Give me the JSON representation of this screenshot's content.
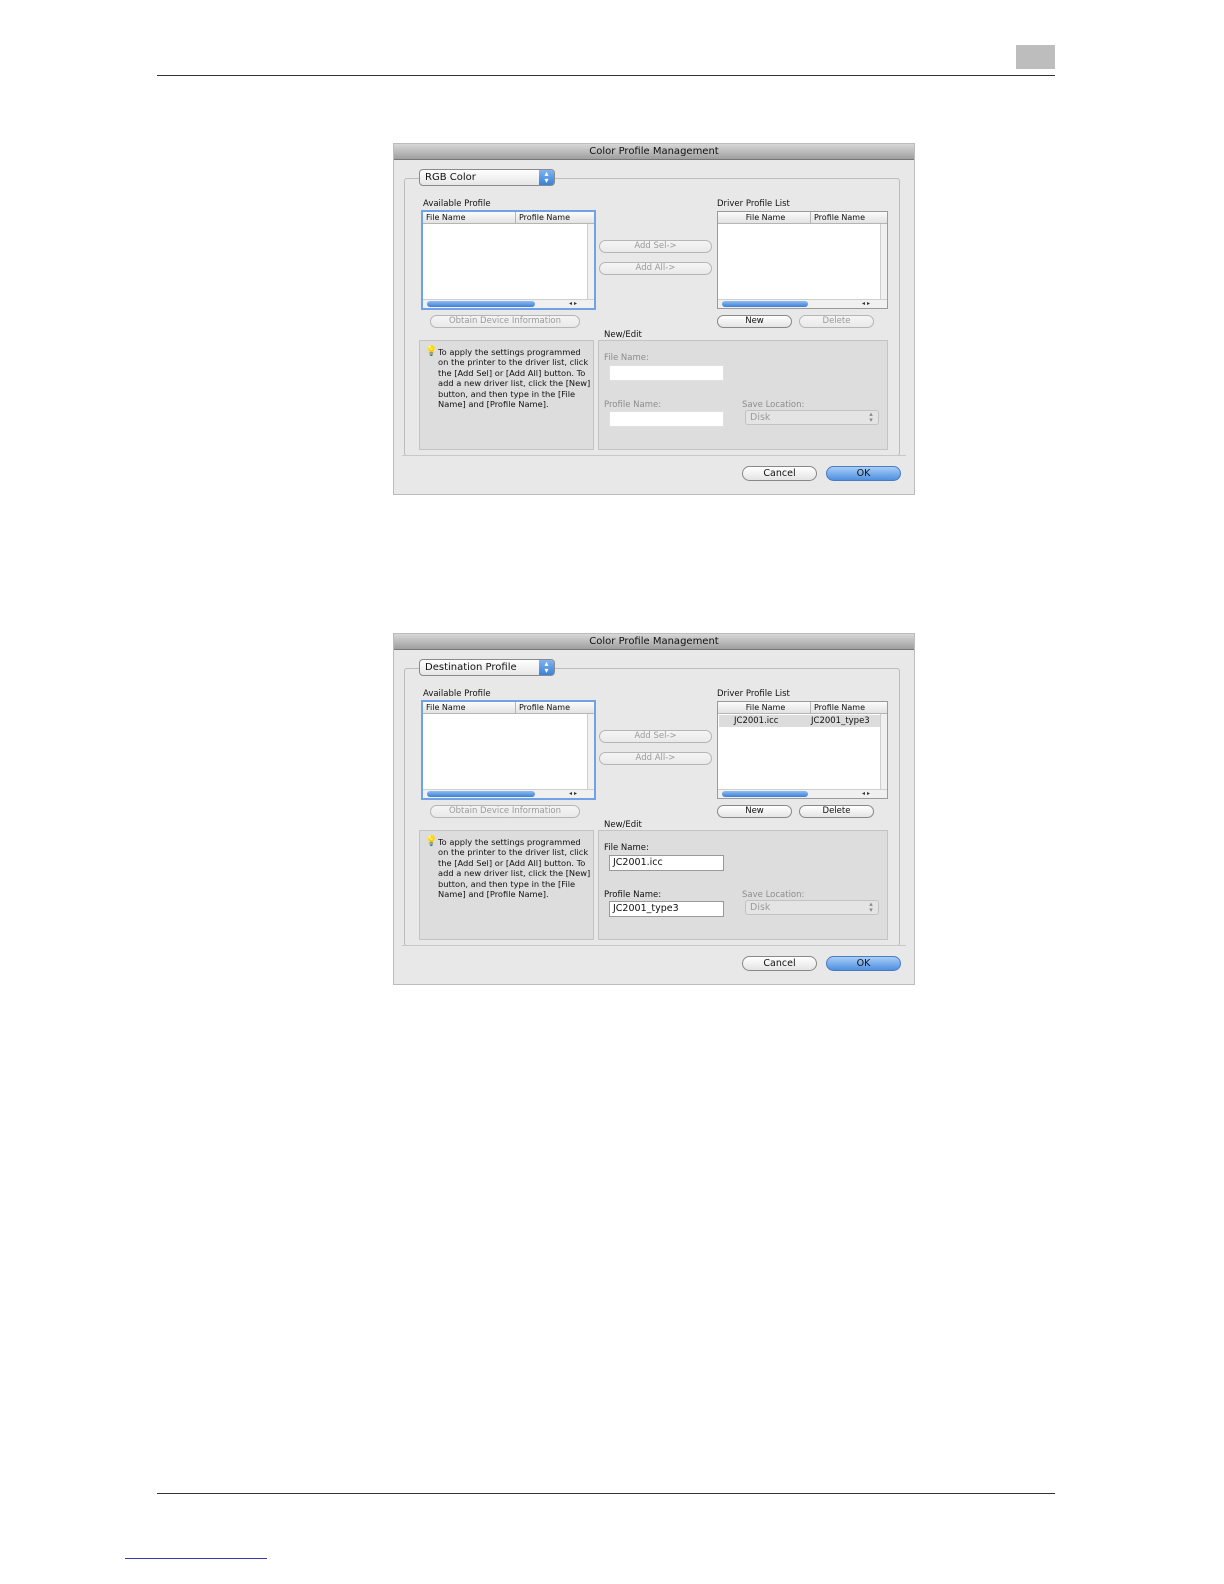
{
  "dialogs": [
    {
      "title": "Color Profile Management",
      "profile_type": "RGB Color",
      "available_label": "Available Profile",
      "driver_list_label": "Driver Profile List",
      "col_file": "File Name",
      "col_profile": "Profile Name",
      "driver_rows": [],
      "add_sel": "Add Sel->",
      "add_all": "Add All->",
      "obtain": "Obtain Device Information",
      "new_btn": "New",
      "delete_btn": "Delete",
      "delete_enabled": false,
      "new_edit_label": "New/Edit",
      "hint": "To apply the settings programmed\non the printer to the driver list, click\nthe [Add Sel] or [Add All] button. To\nadd a new driver list, click the [New]\nbutton, and then type in the [File\nName] and [Profile Name].",
      "file_name_label": "File Name:",
      "file_name_value": "",
      "profile_name_label": "Profile Name:",
      "profile_name_value": "",
      "fields_enabled": false,
      "save_location_label": "Save Location:",
      "save_location_value": "Disk",
      "cancel": "Cancel",
      "ok": "OK"
    },
    {
      "title": "Color Profile Management",
      "profile_type": "Destination Profile",
      "available_label": "Available Profile",
      "driver_list_label": "Driver Profile List",
      "col_file": "File Name",
      "col_profile": "Profile Name",
      "driver_rows": [
        {
          "file": "JC2001.icc",
          "profile": "JC2001_type3"
        }
      ],
      "add_sel": "Add Sel->",
      "add_all": "Add All->",
      "obtain": "Obtain Device Information",
      "new_btn": "New",
      "delete_btn": "Delete",
      "delete_enabled": true,
      "new_edit_label": "New/Edit",
      "hint": "To apply the settings programmed\non the printer to the driver list, click\nthe [Add Sel] or [Add All] button. To\nadd a new driver list, click the [New]\nbutton, and then type in the [File\nName] and [Profile Name].",
      "file_name_label": "File Name:",
      "file_name_value": "JC2001.icc",
      "profile_name_label": "Profile Name:",
      "profile_name_value": "JC2001_type3",
      "fields_enabled": true,
      "save_location_label": "Save Location:",
      "save_location_value": "Disk",
      "cancel": "Cancel",
      "ok": "OK"
    }
  ]
}
